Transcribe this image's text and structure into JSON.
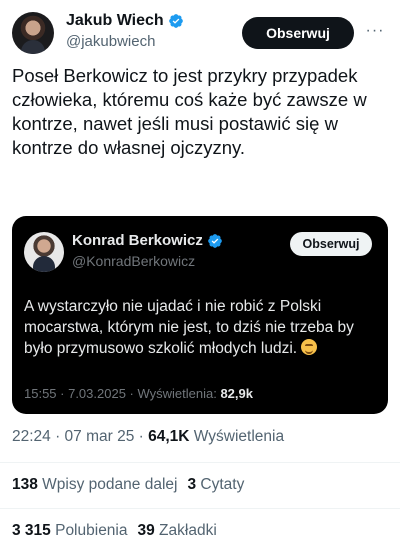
{
  "author": {
    "name": "Jakub Wiech",
    "handle": "@jakubwiech",
    "follow_label": "Obserwuj",
    "more_icon": "···"
  },
  "tweet": {
    "text": "Poseł Berkowicz to jest przykry przypadek człowieka, któremu coś każe być zawsze w kontrze, nawet jeśli musi postawić się w kontrze do własnej ojczyzny."
  },
  "quote": {
    "name": "Konrad Berkowicz",
    "handle": "@KonradBerkowicz",
    "follow_label": "Obserwuj",
    "text": "A wystarczyło nie ujadać i nie robić z Polski mocarstwa, którym nie jest, to dziś nie trzeba by było przymusowo szkolić młodych ludzi.",
    "emoji": "smirking-face-emoji",
    "time": "15:55 · 7.03.2025 · Wyświetlenia: ",
    "views": "82,9k"
  },
  "meta": {
    "time": "22:24 · 07 mar 25 · ",
    "views": "64,1K",
    "views_label": " Wyświetlenia"
  },
  "stats": {
    "reposts_count": "138",
    "reposts_label": " Wpisy podane dalej",
    "quotes_count": "3",
    "quotes_label": " Cytaty",
    "likes_count": "3 315",
    "likes_label": " Polubienia",
    "bookmarks_count": "39",
    "bookmarks_label": " Zakładki"
  },
  "colors": {
    "verified": "#1d9bf0",
    "text_primary": "#0f1419",
    "text_secondary": "#536471"
  }
}
